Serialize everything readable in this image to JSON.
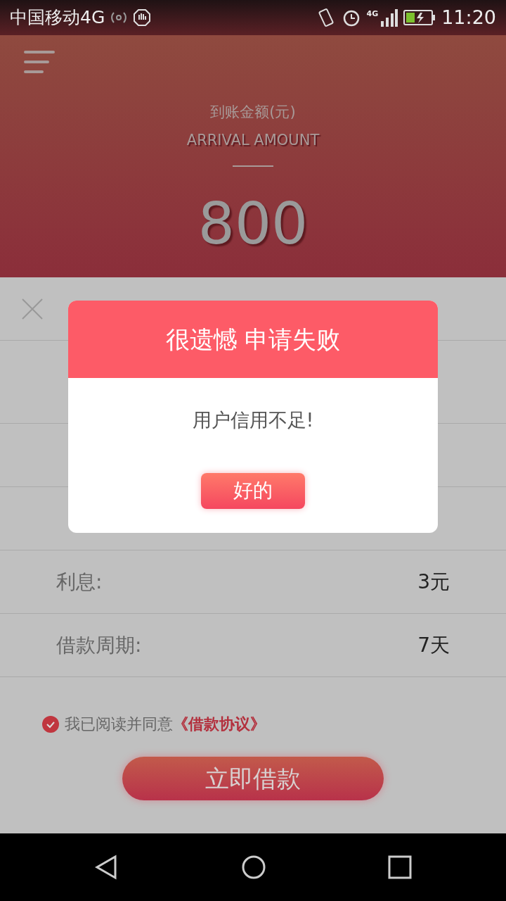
{
  "status_bar": {
    "carrier": "中国移动4G",
    "network": "4G",
    "time": "11:20"
  },
  "header": {
    "title": "到账金额(元)",
    "subtitle": "ARRIVAL AMOUNT",
    "amount": "800"
  },
  "details": {
    "rows": [
      {
        "label": "利息:",
        "value": "3元"
      },
      {
        "label": "借款周期:",
        "value": "7天"
      }
    ]
  },
  "agreement": {
    "checked": true,
    "text": "我已阅读并同意",
    "link": "《借款协议》"
  },
  "submit_button": "立即借款",
  "dialog": {
    "title": "很遗憾 申请失败",
    "message": "用户信用不足!",
    "button": "好的"
  }
}
